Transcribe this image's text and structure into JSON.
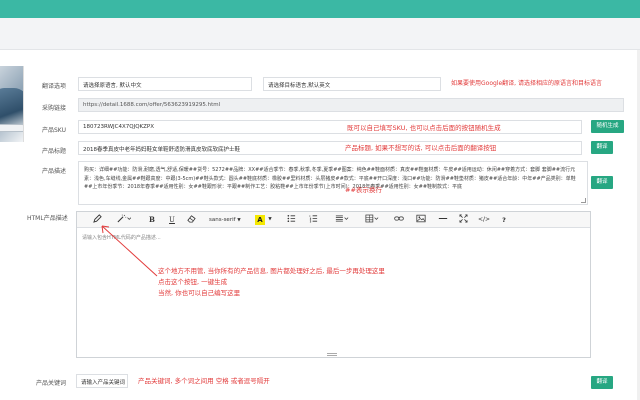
{
  "translate": {
    "label": "翻译选项",
    "source_select": "请选择原语言, 默认中文",
    "target_select": "请选择目标语言,默认英文",
    "note": "如果要使用Google翻译, 请选择相应的原语言和目标语言"
  },
  "source_link": {
    "label": "采购链接",
    "value": "https://detail.1688.com/offer/563623919295.html"
  },
  "sku": {
    "label": "产品SKU",
    "value": "180723RWJC4X7QJQKZPX",
    "note": "既可以自己填写SKU, 也可以点击后面的按钮随机生成",
    "button": "随机生成"
  },
  "title": {
    "label": "产品标题",
    "value": "2018春季真皮中老年妈妈鞋女单鞋舒适防滑真皮软底软底护士鞋",
    "note": "产品标题, 如果不想写的话, 可以点击后面的翻译按钮",
    "button": "翻译"
  },
  "description": {
    "label": "产品描述",
    "value": "购买：详细##功能：防滑,耐磨,透气,舒适,保暖##货号：5272##品牌：XX##适合季节：春季,秋季,冬季,夏季##图案：纯色##鞋面材质：真皮##鞋面材质：牛皮##适用运动：休闲##穿着方式：套脚 套脚##流行元素：浅色,车缝线,金属##鞋跟高度：中跟(3-5cm)##鞋头款式：圆头##鞋底材质：橡胶##里料材质：头层猪皮##款式：平底##开口深度：浅口##功能：防滑##鞋垫材质：猪皮##适合年龄：中年##产品类别：单鞋##上市年份季节：2018年春季##适用性别：女##鞋跟形状：平跟##制作工艺：胶粘鞋##上市年份季节(上市时间)：2018年春季##适用性别：女##鞋制款式：平底",
    "note": "##表示换行",
    "button": "翻译"
  },
  "html_desc": {
    "label": "HTML产品描述",
    "font_name": "sans-serif",
    "placeholder": "请输入包含HTML代码的产品描述...",
    "note_line1": "这个地方不用管, 当你所有的产品信息, 图片都处理好之后, 最后一步再处理这里",
    "note_line2": "点击这个按钮, 一键生成",
    "note_line3": "当然, 你也可以自己编写这里",
    "toolbar": {
      "bold": "B",
      "underline": "U",
      "color": "A",
      "code": "</>",
      "help": "?"
    }
  },
  "keywords": {
    "label": "产品关键词",
    "placeholder": "请输入产品关键词",
    "note": "产品关键词, 多个词之间用 空格 或者逗号隔开",
    "button": "翻译"
  },
  "colors": {
    "accent_green": "#27a782",
    "top_bar": "#3bb8a4",
    "note_red": "#e23b3b"
  }
}
